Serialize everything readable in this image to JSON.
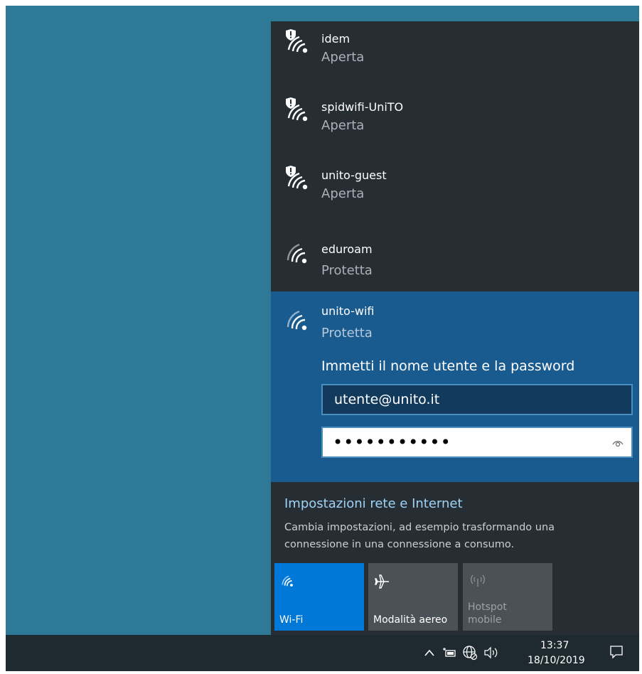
{
  "networks": [
    {
      "name": "idem",
      "status": "Aperta",
      "icon": "wifi-open-shield-icon"
    },
    {
      "name": "spidwifi-UniTO",
      "status": "Aperta",
      "icon": "wifi-open-shield-icon"
    },
    {
      "name": "unito-guest",
      "status": "Aperta",
      "icon": "wifi-open-shield-icon"
    },
    {
      "name": "eduroam",
      "status": "Protetta",
      "icon": "wifi-icon"
    }
  ],
  "selected_network": {
    "name": "unito-wifi",
    "status": "Protetta",
    "prompt": "Immetti il nome utente e la password",
    "username_value": "utente@unito.it",
    "password_value": "•••••••••••"
  },
  "settings": {
    "link_label": "Impostazioni rete e Internet",
    "description": "Cambia impostazioni, ad esempio trasformando una connessione in una connessione a consumo."
  },
  "quick_actions": {
    "wifi_label": "Wi-Fi",
    "airplane_label": "Modalità aereo",
    "hotspot_label_line1": "Hotspot",
    "hotspot_label_line2": "mobile"
  },
  "taskbar": {
    "time": "13:37",
    "date": "18/10/2019"
  },
  "colors": {
    "desktop": "#2e7a96",
    "flyout": "#262d33",
    "selected": "#1a5b8f",
    "accent": "#0078d7"
  }
}
